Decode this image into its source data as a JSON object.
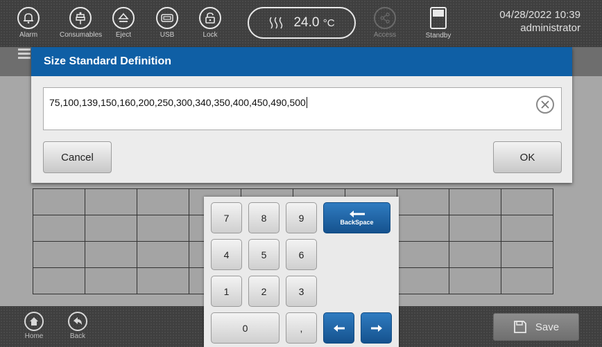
{
  "topbar": {
    "buttons": [
      {
        "label": "Alarm",
        "icon": "bell-icon"
      },
      {
        "label": "Consumables",
        "icon": "consumables-icon"
      },
      {
        "label": "Eject",
        "icon": "eject-icon"
      },
      {
        "label": "USB",
        "icon": "usb-icon"
      },
      {
        "label": "Lock",
        "icon": "lock-icon"
      }
    ],
    "temperature": {
      "value": "24.0",
      "unit": "°C"
    },
    "access_label": "Access",
    "standby_label": "Standby",
    "datetime": "04/28/2022 10:39",
    "user": "administrator"
  },
  "dialog": {
    "title": "Size Standard Definition",
    "input_value": "75,100,139,150,160,200,250,300,340,350,400,450,490,500",
    "cancel_label": "Cancel",
    "ok_label": "OK"
  },
  "keypad": {
    "digits": [
      "7",
      "8",
      "9",
      "4",
      "5",
      "6",
      "1",
      "2",
      "3",
      "0"
    ],
    "comma": ",",
    "backspace_label": "BackSpace"
  },
  "bottombar": {
    "home_label": "Home",
    "back_label": "Back",
    "save_label": "Save"
  },
  "colors": {
    "accent": "#0f5fa5",
    "topbar": "#3f3f3f"
  }
}
